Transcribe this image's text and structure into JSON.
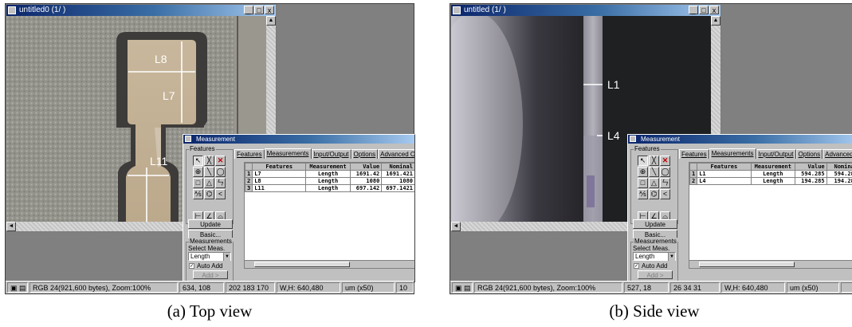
{
  "figure_a": {
    "caption": "(a) Top view",
    "window_title": "untitled0 (1/ )",
    "labels": [
      "L8",
      "L7",
      "L11"
    ],
    "dialog_title": "Measurement",
    "tabs": [
      "Features",
      "Measurements",
      "Input/Output",
      "Options",
      "Advanced Opt."
    ],
    "columns": [
      "",
      "Features",
      "Measurement",
      "Value",
      "Nominal"
    ],
    "rows": [
      [
        "1",
        "L7",
        "Length",
        "1691.42",
        "1691.421"
      ],
      [
        "2",
        "L8",
        "Length",
        "1080",
        "1080"
      ],
      [
        "3",
        "L11",
        "Length",
        "697.142",
        "697.1421"
      ]
    ],
    "status": {
      "mode": "RGB 24(921,600 bytes), Zoom:100%",
      "pos": "634, 108",
      "color": "202 183 170",
      "size": "W,H: 640,480",
      "unit": "um (x50)",
      "extra": "10"
    }
  },
  "figure_b": {
    "caption": "(b) Side view",
    "window_title": "untitled (1/ )",
    "labels": [
      "L1",
      "L4"
    ],
    "dialog_title": "Measurement",
    "tabs": [
      "Features",
      "Measurements",
      "Input/Output",
      "Options",
      "Advanced Opt."
    ],
    "columns": [
      "",
      "Features",
      "Measurement",
      "Value",
      "Nominal"
    ],
    "rows": [
      [
        "1",
        "L1",
        "Length",
        "594.285",
        "594.285"
      ],
      [
        "2",
        "L4",
        "Length",
        "194.285",
        "194.285"
      ]
    ],
    "status": {
      "mode": "RGB 24(921,600 bytes), Zoom:100%",
      "pos": "527, 18",
      "color": "26 34 31",
      "size": "W,H: 640,480",
      "unit": "um (x50)",
      "extra": ""
    }
  },
  "dialog_ui": {
    "features_group": "Features",
    "update": "Update",
    "basic": "Basic...",
    "measurements_group": "Measurements",
    "select_meas": "Select Meas.",
    "select_value": "Length",
    "auto_add": "Auto Add",
    "add": "Add >",
    "remove": "Remove <"
  },
  "tools": [
    "↖",
    "╳",
    "✕",
    "⊕",
    "╲",
    "◯",
    "□",
    "△",
    "ㄣ",
    "⅍",
    "⌬",
    "<",
    "⊢",
    "∠",
    "⌓",
    "⅏",
    "≣",
    "◈"
  ],
  "window_buttons": [
    "_",
    "□",
    "x"
  ]
}
